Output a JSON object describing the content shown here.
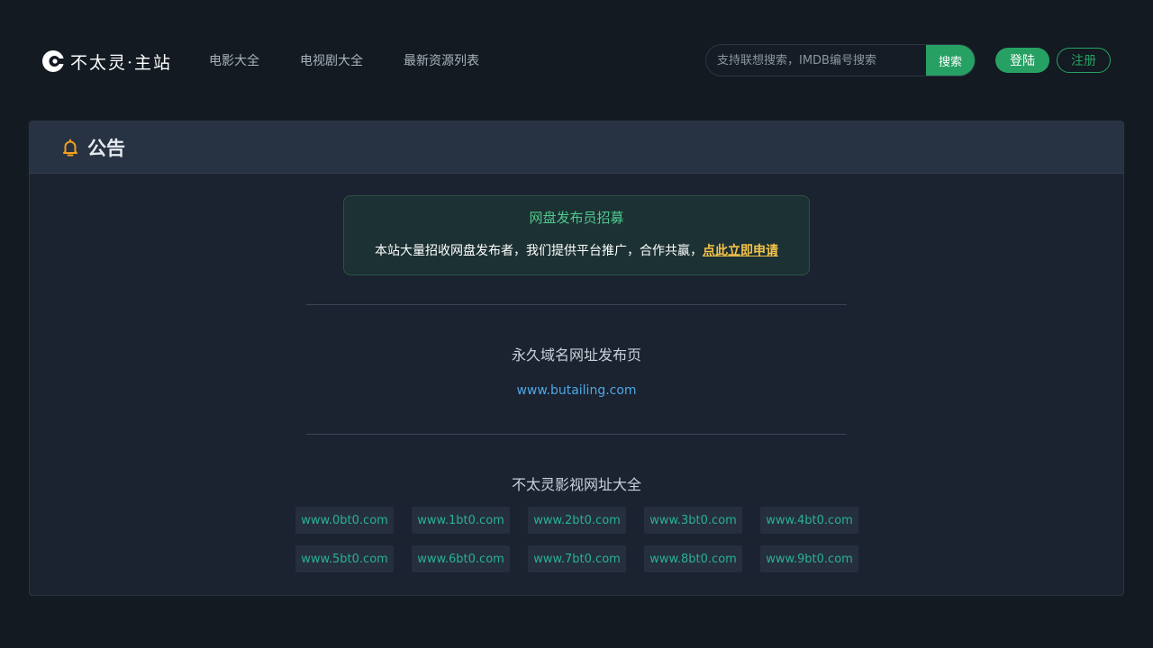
{
  "brand": {
    "name": "不太灵·主站"
  },
  "nav": [
    {
      "label": "电影大全"
    },
    {
      "label": "电视剧大全"
    },
    {
      "label": "最新资源列表"
    }
  ],
  "search": {
    "placeholder": "支持联想搜索，IMDB编号搜索",
    "button": "搜索"
  },
  "auth": {
    "login": "登陆",
    "register": "注册"
  },
  "notice": {
    "title": "公告",
    "recruit": {
      "title": "网盘发布员招募",
      "text": "本站大量招收网盘发布者，我们提供平台推广，合作共赢，",
      "link": "点此立即申请"
    },
    "permanent": {
      "title": "永久域名网址发布页",
      "url": "www.butailing.com"
    },
    "mirrors": {
      "title": "不太灵影视网址大全",
      "rows": [
        [
          "www.0bt0.com",
          "www.1bt0.com",
          "www.2bt0.com",
          "www.3bt0.com",
          "www.4bt0.com"
        ],
        [
          "www.5bt0.com",
          "www.6bt0.com",
          "www.7bt0.com",
          "www.8bt0.com",
          "www.9bt0.com"
        ]
      ]
    }
  },
  "colors": {
    "accent": "#27a163",
    "link": "#4ea8e4",
    "highlight": "#f5c34a",
    "mirror": "#2ab094"
  }
}
